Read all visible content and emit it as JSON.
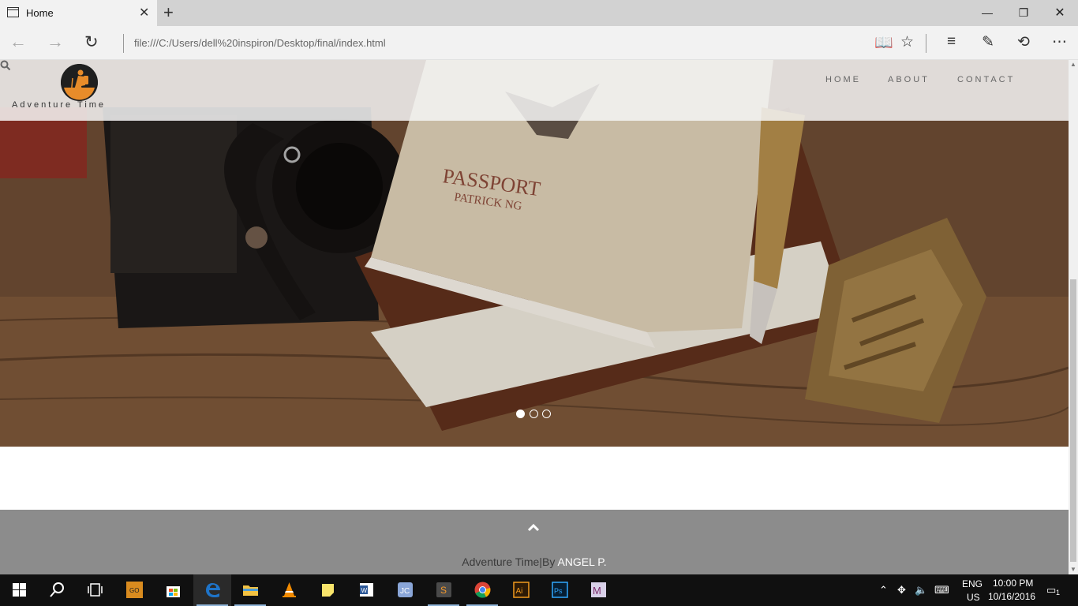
{
  "browser": {
    "tab_title": "Home",
    "url": "file:///C:/Users/dell%20inspiron/Desktop/final/index.html"
  },
  "site": {
    "logo_text": "Adventure Time",
    "nav": [
      {
        "label": "HOME"
      },
      {
        "label": "ABOUT"
      },
      {
        "label": "CONTACT"
      }
    ],
    "hero": {
      "slide_count": 3,
      "active_slide": 1,
      "image_text": {
        "passport": "PASSPORT",
        "name": "PATRICK NG"
      }
    },
    "footer": {
      "prefix": "Adventure Time|By ",
      "author": "ANGEL P."
    }
  },
  "taskbar": {
    "apps": [
      "start",
      "search",
      "task-view",
      "csgo",
      "store",
      "edge",
      "file-explorer",
      "vlc",
      "sticky-notes",
      "word",
      "jcreator",
      "sublime-text",
      "chrome",
      "illustrator",
      "photoshop",
      "maple"
    ],
    "active_app": "edge",
    "lang_line1": "ENG",
    "lang_line2": "US",
    "time": "10:00 PM",
    "date": "10/16/2016",
    "notification_count": "1"
  },
  "colors": {
    "footer_bg": "#8c8c8c",
    "header_bg": "#f5f5f5",
    "taskbar_bg": "#101010",
    "edge_blue": "#1e74c9"
  }
}
